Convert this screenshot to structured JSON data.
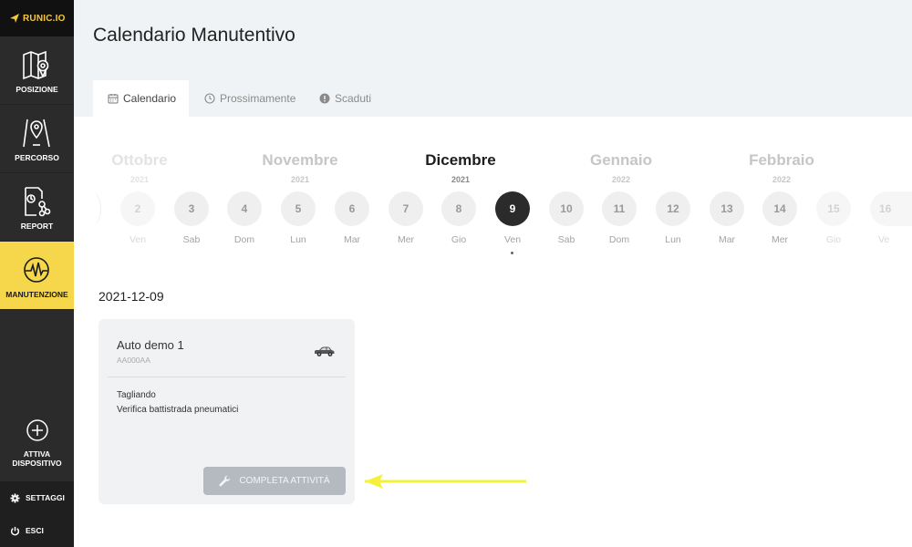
{
  "brand": {
    "logo_text": "RUNIC.IO"
  },
  "sidebar": {
    "items": [
      {
        "label": "POSIZIONE"
      },
      {
        "label": "PERCORSO"
      },
      {
        "label": "REPORT"
      },
      {
        "label": "MANUTENZIONE",
        "active": true
      }
    ],
    "attiva_label_1": "ATTIVA",
    "attiva_label_2": "DISPOSITIVO",
    "settings_label": "SETTAGGI",
    "logout_label": "ESCI"
  },
  "header": {
    "title": "Calendario Manutentivo",
    "tabs": [
      {
        "label": "Calendario",
        "icon": "calendar-icon",
        "active": true
      },
      {
        "label": "Prossimamente",
        "icon": "clock-icon"
      },
      {
        "label": "Scaduti",
        "icon": "alert-icon"
      }
    ]
  },
  "calendar": {
    "months": [
      {
        "name": "Ottobre",
        "year": "2021"
      },
      {
        "name": "Novembre",
        "year": "2021"
      },
      {
        "name": "Dicembre",
        "year": "2021",
        "current": true
      },
      {
        "name": "Gennaio",
        "year": "2022"
      },
      {
        "name": "Febbraio",
        "year": "2022"
      }
    ],
    "days": [
      {
        "num": "2",
        "dow": "Ven"
      },
      {
        "num": "3",
        "dow": "Sab"
      },
      {
        "num": "4",
        "dow": "Dom"
      },
      {
        "num": "5",
        "dow": "Lun"
      },
      {
        "num": "6",
        "dow": "Mar"
      },
      {
        "num": "7",
        "dow": "Mer"
      },
      {
        "num": "8",
        "dow": "Gio"
      },
      {
        "num": "9",
        "dow": "Ven",
        "selected": true
      },
      {
        "num": "10",
        "dow": "Sab"
      },
      {
        "num": "11",
        "dow": "Dom"
      },
      {
        "num": "12",
        "dow": "Lun"
      },
      {
        "num": "13",
        "dow": "Mar"
      },
      {
        "num": "14",
        "dow": "Mer"
      },
      {
        "num": "15",
        "dow": "Gio"
      },
      {
        "num": "16",
        "dow": "Ve"
      }
    ],
    "selected_date": "2021-12-09"
  },
  "card": {
    "vehicle_name": "Auto demo 1",
    "plate": "AA000AA",
    "tasks": [
      "Tagliando",
      "Verifica battistrada pneumatici"
    ],
    "complete_button": "COMPLETA ATTIVITÀ"
  },
  "colors": {
    "sidebar_bg": "#2b2b2b",
    "accent_yellow": "#f6d64a",
    "header_bg": "#eff3f5",
    "annotation_arrow": "#f5f03a"
  }
}
